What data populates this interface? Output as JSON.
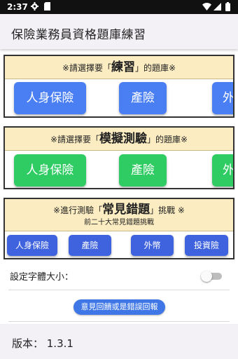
{
  "statusbar": {
    "time": "2:37"
  },
  "appbar": {
    "title": "保險業務員資格題庫練習"
  },
  "practice": {
    "prefix": "※請選擇要「",
    "emph": "練習",
    "suffix": "」的題庫※",
    "buttons": [
      "人身保險",
      "產險",
      "外"
    ]
  },
  "mock": {
    "prefix": "※請選擇要「",
    "emph": "模擬測驗",
    "suffix": "」的題庫※",
    "buttons": [
      "人身保險",
      "產險",
      "外"
    ]
  },
  "common": {
    "prefix": "※進行測驗「",
    "emph": "常見錯題",
    "suffix": "」挑戰 ※",
    "subtitle": "前二十大常見錯題挑戰",
    "buttons": [
      "人身保險",
      "產險",
      "外幣",
      "投資險"
    ]
  },
  "settings": {
    "font_size_label": "設定字體大小：",
    "font_size_toggle_on": false
  },
  "feedback_label": "意見回饋或是錯誤回報",
  "footer": {
    "version": "版本： 1.3.1"
  }
}
